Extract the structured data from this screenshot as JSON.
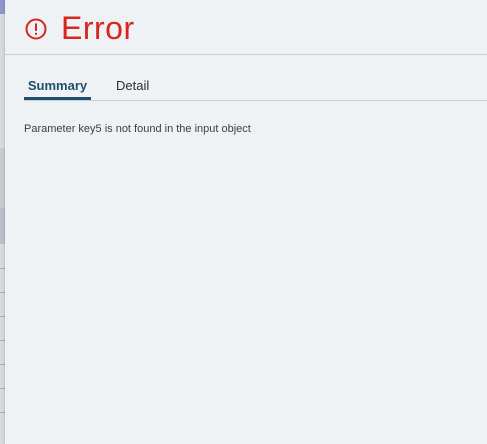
{
  "dialog": {
    "title": "Error",
    "icon": "alert-circle-icon",
    "accent_color": "#d9261c"
  },
  "tabs": [
    {
      "label": "Summary",
      "active": true
    },
    {
      "label": "Detail",
      "active": false
    }
  ],
  "summary": {
    "message": "Parameter key5 is not found in the input object"
  }
}
